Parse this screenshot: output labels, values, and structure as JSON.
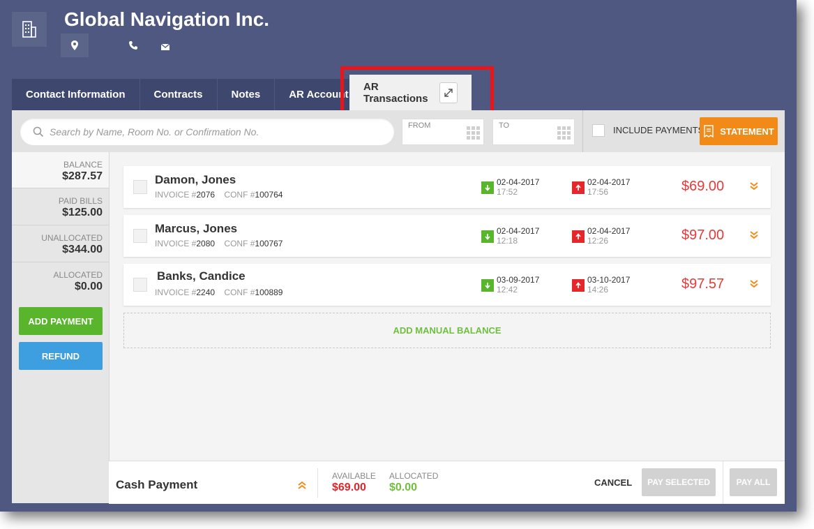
{
  "header": {
    "company_name": "Global Navigation Inc."
  },
  "tabs": [
    {
      "label": "Contact Information"
    },
    {
      "label": "Contracts"
    },
    {
      "label": "Notes"
    },
    {
      "label": "AR Account"
    },
    {
      "label": "AR Transactions",
      "active": true
    }
  ],
  "toolbar": {
    "search_placeholder": "Search by Name, Room No. or Confirmation No.",
    "from_label": "FROM",
    "to_label": "TO",
    "include_payments_label": "INCLUDE PAYMENTS",
    "statement_label": "STATEMENT"
  },
  "sidebar": {
    "balance": {
      "label": "BALANCE",
      "value": "$287.57"
    },
    "paid_bills": {
      "label": "PAID BILLS",
      "value": "$125.00"
    },
    "unallocated": {
      "label": "UNALLOCATED",
      "value": "$344.00"
    },
    "allocated": {
      "label": "ALLOCATED",
      "value": "$0.00"
    },
    "add_payment_label": "ADD PAYMENT",
    "refund_label": "REFUND"
  },
  "transactions": [
    {
      "name": "Damon, Jones",
      "invoice_label": "INVOICE #",
      "invoice": "2076",
      "conf_label": "CONF #",
      "conf": "100764",
      "arrival_date": "02-04-2017",
      "arrival_time": "17:52",
      "departure_date": "02-04-2017",
      "departure_time": "17:56",
      "amount": "$69.00"
    },
    {
      "name": "Marcus, Jones",
      "invoice_label": "INVOICE #",
      "invoice": "2080",
      "conf_label": "CONF #",
      "conf": "100767",
      "arrival_date": "02-04-2017",
      "arrival_time": "12:18",
      "departure_date": "02-04-2017",
      "departure_time": "12:26",
      "amount": "$97.00"
    },
    {
      "name": "Banks, Candice",
      "invoice_label": "INVOICE #",
      "invoice": "2240",
      "conf_label": "CONF #",
      "conf": "100889",
      "arrival_date": "03-09-2017",
      "arrival_time": "12:42",
      "departure_date": "03-10-2017",
      "departure_time": "14:26",
      "amount": "$97.57"
    }
  ],
  "add_manual_balance_label": "ADD MANUAL BALANCE",
  "footer": {
    "title": "Cash Payment",
    "available_label": "AVAILABLE",
    "available_value": "$69.00",
    "allocated_label": "ALLOCATED",
    "allocated_value": "$0.00",
    "cancel_label": "CANCEL",
    "pay_selected_label": "PAY SELECTED",
    "pay_all_label": "PAY ALL"
  },
  "colors": {
    "header_bg": "#4f5880",
    "tab_bg": "#3e476d",
    "accent_orange": "#f28a18",
    "green": "#58b52c",
    "blue": "#3d9fdf",
    "amount_red": "#e53a3a",
    "highlight_red": "#e8161a"
  },
  "icons": [
    "building-icon",
    "location-pin-icon",
    "phone-icon",
    "mail-icon",
    "expand-icon",
    "search-icon",
    "calendar-grid-icon",
    "receipt-icon",
    "arrow-down-icon",
    "arrow-up-icon",
    "chevron-double-down-icon",
    "chevron-double-up-icon"
  ]
}
